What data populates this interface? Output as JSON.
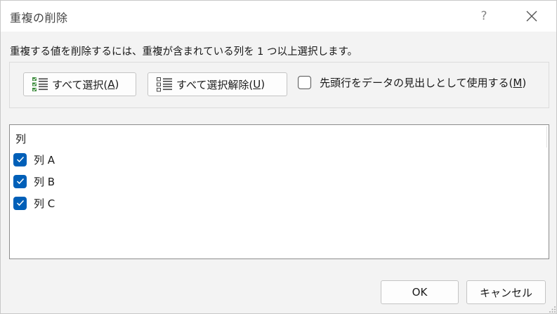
{
  "window": {
    "title": "重複の削除",
    "help_label": "?"
  },
  "instruction": "重複する値を削除するには、重複が含まれている列を 1 つ以上選択します。",
  "options": {
    "select_all": {
      "label": "すべて選択(",
      "accel": "A",
      "close": ")"
    },
    "unselect_all": {
      "label": "すべて選択解除(",
      "accel": "U",
      "close": ")"
    },
    "header_checkbox": {
      "label": "先頭行をデータの見出しとして使用する(",
      "accel": "M",
      "close": ")",
      "checked": false
    }
  },
  "columns_list": {
    "header": "列",
    "items": [
      {
        "label": "列 A",
        "checked": true
      },
      {
        "label": "列 B",
        "checked": true
      },
      {
        "label": "列 C",
        "checked": true
      }
    ]
  },
  "footer": {
    "ok_label": "OK",
    "cancel_label": "キャンセル"
  },
  "colors": {
    "accent": "#005fb8",
    "background": "#f3f3f3",
    "select_all_icon": "#3a8a3a"
  }
}
